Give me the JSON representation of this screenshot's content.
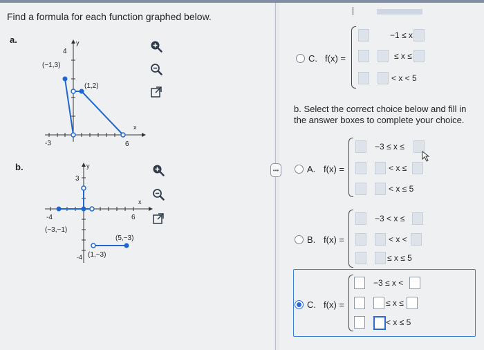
{
  "question": {
    "title": "Find a formula for each function graphed below.",
    "part_a_label": "a.",
    "part_b_label": "b."
  },
  "graph_a": {
    "points": [
      {
        "label": "(−1,3)"
      },
      {
        "label": "(1,2)"
      }
    ],
    "tick_labels": {
      "y_top": "4",
      "x_left": "-3",
      "x_right": "6",
      "x_axis": "x",
      "y_axis": "y"
    }
  },
  "graph_b": {
    "points": [
      {
        "label": "(−3,−1)"
      },
      {
        "label": "(5,−3)"
      },
      {
        "label": "(1,−3)"
      }
    ],
    "tick_labels": {
      "y_top": "3",
      "y_bottom": "-4",
      "x_left": "-4",
      "x_right": "6",
      "x_axis": "x",
      "y_axis": "y"
    }
  },
  "part_a_choice_c": {
    "letter": "C.",
    "fx": "f(x) =",
    "rows": [
      {
        "cond": "−1 ≤ x <"
      },
      {
        "cond": "≤ x ≤"
      },
      {
        "cond": "< x < 5"
      }
    ]
  },
  "part_b": {
    "instruction": "b. Select the correct choice below and fill in the answer boxes to complete your choice.",
    "choices": [
      {
        "letter": "A.",
        "fx": "f(x) =",
        "rows": [
          "−3 ≤ x ≤",
          "< x ≤",
          "< x ≤ 5"
        ],
        "selected": false
      },
      {
        "letter": "B.",
        "fx": "f(x) =",
        "rows": [
          "−3 < x ≤",
          "< x <",
          "≤ x ≤ 5"
        ],
        "selected": false
      },
      {
        "letter": "C.",
        "fx": "f(x) =",
        "rows": [
          "−3 ≤ x <",
          "≤ x ≤",
          "< x ≤ 5"
        ],
        "selected": true
      }
    ]
  },
  "separator_label": "•••",
  "colors": {
    "accent": "#2b6bd6",
    "graph_point": "#1f66d0",
    "graph_line": "#1f66d0"
  }
}
